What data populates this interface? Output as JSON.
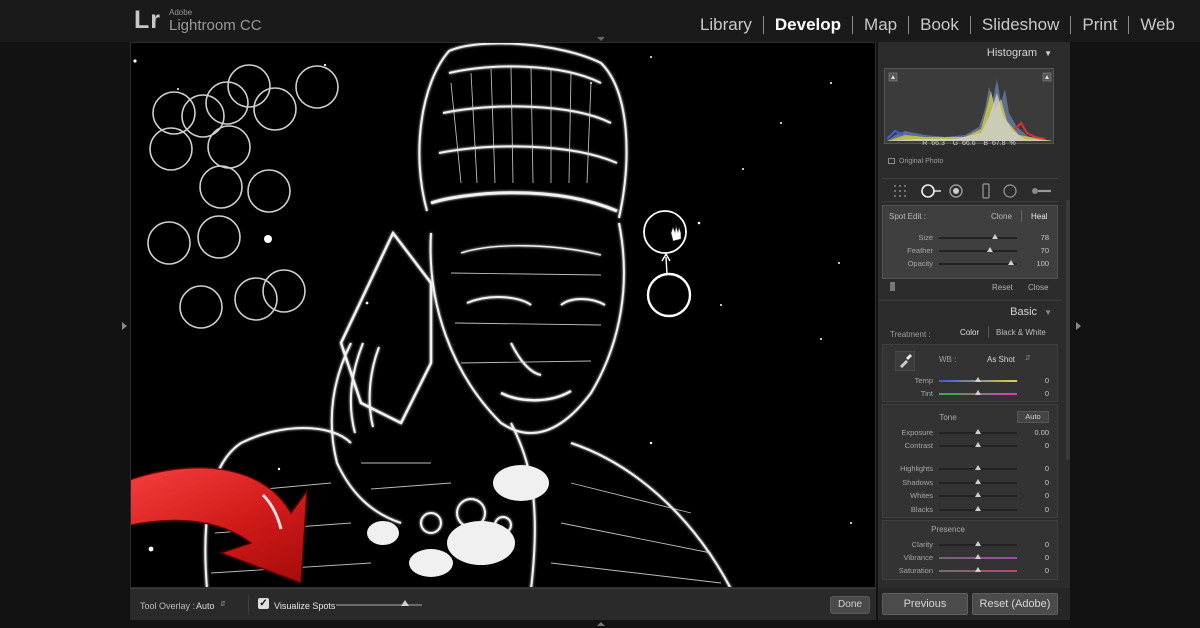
{
  "app": {
    "brand_mark": "Lr",
    "vendor": "Adobe",
    "product": "Lightroom CC"
  },
  "modules": [
    {
      "label": "Library",
      "active": false
    },
    {
      "label": "Develop",
      "active": true
    },
    {
      "label": "Map",
      "active": false
    },
    {
      "label": "Book",
      "active": false
    },
    {
      "label": "Slideshow",
      "active": false
    },
    {
      "label": "Print",
      "active": false
    },
    {
      "label": "Web",
      "active": false
    }
  ],
  "toolbar": {
    "tool_overlay_label": "Tool Overlay :",
    "tool_overlay_value": "Auto",
    "visualize_spots_label": "Visualize Spots",
    "visualize_spots_checked": true,
    "visualize_threshold": 0.8,
    "done_label": "Done"
  },
  "histogram": {
    "title": "Histogram",
    "r_label": "R",
    "r_value": "66.3",
    "g_label": "G",
    "g_value": "66.6",
    "b_label": "B",
    "b_value": "67.8",
    "percent": "%",
    "original_photo_label": "Original Photo"
  },
  "spot_edit": {
    "title": "Spot Edit :",
    "clone_label": "Clone",
    "heal_label": "Heal",
    "sliders": [
      {
        "label": "Size",
        "value": "78",
        "position": 0.72
      },
      {
        "label": "Feather",
        "value": "70",
        "position": 0.66
      },
      {
        "label": "Opacity",
        "value": "100",
        "position": 0.92
      }
    ],
    "reset_label": "Reset",
    "close_label": "Close"
  },
  "basic": {
    "title": "Basic",
    "treatment_label": "Treatment :",
    "color_label": "Color",
    "bw_label": "Black & White",
    "wb_label": "WB :",
    "wb_value": "As Shot",
    "wb_sliders": [
      {
        "label": "Temp",
        "value": "0",
        "position": 0.5
      },
      {
        "label": "Tint",
        "value": "0",
        "position": 0.5
      }
    ],
    "tone_title": "Tone",
    "auto_label": "Auto",
    "tone_sliders": [
      {
        "label": "Exposure",
        "value": "0.00",
        "position": 0.5
      },
      {
        "label": "Contrast",
        "value": "0",
        "position": 0.5
      },
      {
        "label": "Highlights",
        "value": "0",
        "position": 0.5
      },
      {
        "label": "Shadows",
        "value": "0",
        "position": 0.5
      },
      {
        "label": "Whites",
        "value": "0",
        "position": 0.5
      },
      {
        "label": "Blacks",
        "value": "0",
        "position": 0.5
      }
    ],
    "presence_title": "Presence",
    "presence_sliders": [
      {
        "label": "Clarity",
        "value": "0",
        "position": 0.5
      },
      {
        "label": "Vibrance",
        "value": "0",
        "position": 0.5
      },
      {
        "label": "Saturation",
        "value": "0",
        "position": 0.5
      }
    ]
  },
  "actions": {
    "previous_label": "Previous",
    "reset_label": "Reset (Adobe)"
  },
  "icons": {
    "arrow_color": "#d42020",
    "visualize_bg": "#000000",
    "spot_pin_color": "#ffffff"
  }
}
